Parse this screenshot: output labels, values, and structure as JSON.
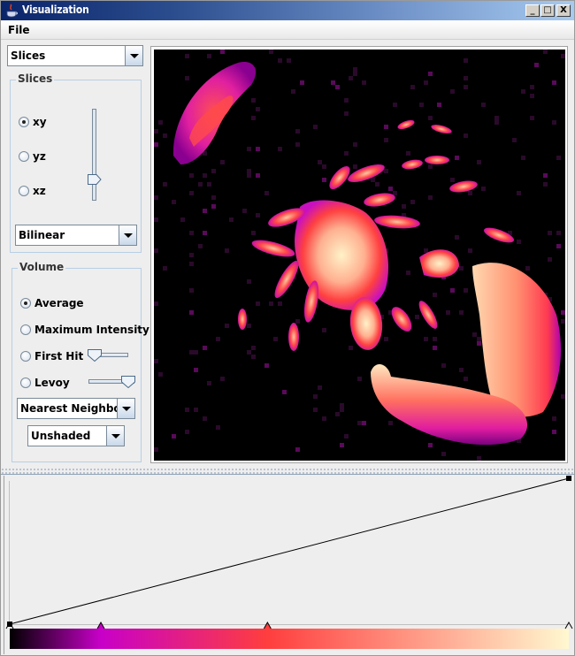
{
  "window": {
    "title": "Visualization",
    "buttons": {
      "minimize": "_",
      "maximize": "□",
      "close": "X"
    }
  },
  "menubar": {
    "items": [
      {
        "label": "File"
      }
    ]
  },
  "left_panel": {
    "mode_select": {
      "selected": "Slices"
    },
    "slices_group": {
      "title": "Slices",
      "orientation_options": [
        {
          "label": "xy",
          "selected": true
        },
        {
          "label": "yz",
          "selected": false
        },
        {
          "label": "xz",
          "selected": false
        }
      ],
      "slice_slider_value_fraction": 0.2,
      "interpolation_select": {
        "selected": "Bilinear"
      }
    },
    "volume_group": {
      "title": "Volume",
      "render_options": [
        {
          "label": "Average",
          "selected": true
        },
        {
          "label": "Maximum Intensity",
          "selected": false
        },
        {
          "label": "First Hit",
          "selected": false
        },
        {
          "label": "Levoy",
          "selected": false
        }
      ],
      "first_hit_slider_fraction": 0.0,
      "levoy_slider_fraction": 1.0,
      "interpolation_select": {
        "selected": "Nearest Neighbour"
      },
      "shading_select": {
        "selected": "Unshaded"
      }
    }
  },
  "viewport": {
    "description": "rendered xy slice of scorpion volume with magma-like colormap",
    "background": "#000000"
  },
  "transfer_function": {
    "opacity_points": [
      {
        "x": 0.0,
        "y": 0.0
      },
      {
        "x": 1.0,
        "y": 1.0
      }
    ],
    "color_stops": [
      {
        "position": 0.0,
        "color": "#000000"
      },
      {
        "position": 0.163,
        "color": "#c800c8"
      },
      {
        "position": 0.461,
        "color": "#ff3e3e"
      },
      {
        "position": 1.0,
        "color": "#fff8d0"
      }
    ],
    "marker_positions": [
      0.0,
      0.163,
      0.461,
      1.0
    ]
  }
}
